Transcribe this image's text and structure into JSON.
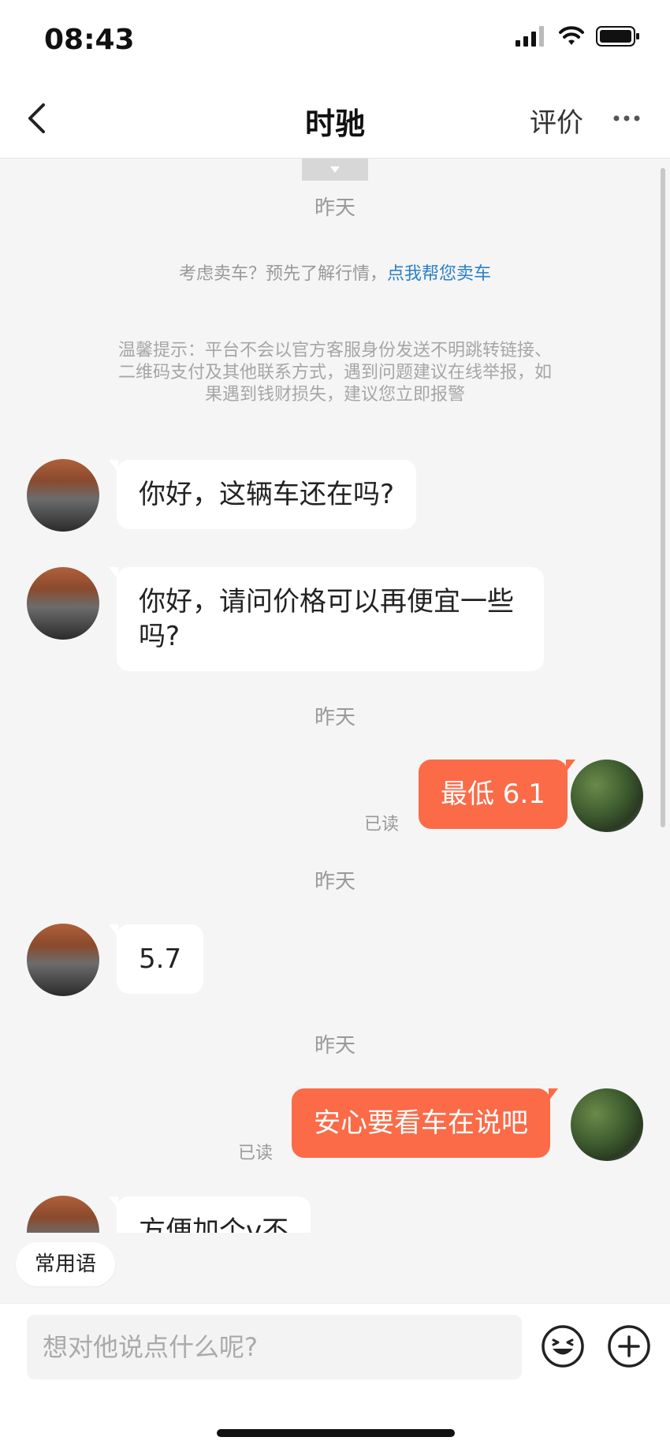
{
  "status": {
    "time": "08:43"
  },
  "nav": {
    "title": "时驰",
    "rate_label": "评价"
  },
  "chat": {
    "time_labels": [
      "昨天",
      "昨天",
      "昨天",
      "昨天"
    ],
    "sell_hint": {
      "text": "考虑卖车？预先了解行情，",
      "link": "点我帮您卖车"
    },
    "warning": "温馨提示：平台不会以官方客服身份发送不明跳转链接、二维码支付及其他联系方式，遇到问题建议在线举报，如果遇到钱财损失，建议您立即报警",
    "messages": [
      {
        "side": "in",
        "text": "你好，这辆车还在吗?"
      },
      {
        "side": "in",
        "text": "你好，请问价格可以再便宜一些吗?"
      },
      {
        "side": "out",
        "text": "最低 6.1",
        "status": "已读"
      },
      {
        "side": "in",
        "text": "5.7"
      },
      {
        "side": "out",
        "text": "安心要看车在说吧",
        "status": "已读"
      },
      {
        "side": "in",
        "text": "方便加个v不"
      }
    ]
  },
  "quick_phrases": {
    "label": "常用语"
  },
  "input": {
    "placeholder": "想对他说点什么呢?"
  },
  "colors": {
    "accent": "#fb6b48",
    "link": "#2a80c8"
  },
  "icons": [
    "back-icon",
    "more-icon",
    "signal-icon",
    "wifi-icon",
    "battery-icon",
    "emoji-icon",
    "plus-icon",
    "expand-arrow-icon"
  ]
}
